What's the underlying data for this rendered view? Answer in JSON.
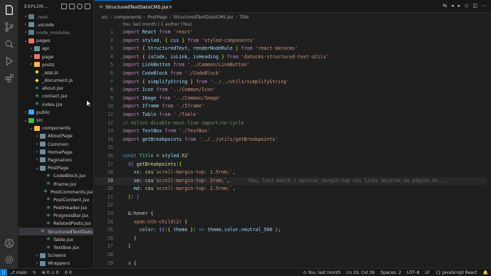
{
  "sidebar": {
    "title": "EXPLOR...",
    "tree": [
      {
        "name": ".next",
        "depth": 0,
        "type": "folder-dim",
        "chev": "›",
        "dim": true
      },
      {
        "name": ".vscode",
        "depth": 0,
        "type": "folder",
        "chev": "›"
      },
      {
        "name": "node_modules",
        "depth": 0,
        "type": "folder-dim",
        "chev": "›",
        "dim": true
      },
      {
        "name": "pages",
        "depth": 0,
        "type": "folder-pages",
        "chev": "⌄"
      },
      {
        "name": "api",
        "depth": 1,
        "type": "folder",
        "chev": "›"
      },
      {
        "name": "page",
        "depth": 1,
        "type": "folder-pages",
        "chev": "›"
      },
      {
        "name": "posts",
        "depth": 1,
        "type": "folder-comp",
        "chev": "›"
      },
      {
        "name": "_app.js",
        "depth": 1,
        "type": "file",
        "chev": ""
      },
      {
        "name": "_document.js",
        "depth": 1,
        "type": "file",
        "chev": ""
      },
      {
        "name": "about.jsx",
        "depth": 1,
        "type": "jsx",
        "chev": ""
      },
      {
        "name": "contact.jsx",
        "depth": 1,
        "type": "jsx",
        "chev": ""
      },
      {
        "name": "index.jsx",
        "depth": 1,
        "type": "jsx",
        "chev": ""
      },
      {
        "name": "public",
        "depth": 0,
        "type": "folder-pub",
        "chev": "›"
      },
      {
        "name": "src",
        "depth": 0,
        "type": "folder-src",
        "chev": "⌄"
      },
      {
        "name": "components",
        "depth": 1,
        "type": "folder-comp",
        "chev": "⌄"
      },
      {
        "name": "AboutPage",
        "depth": 2,
        "type": "folder",
        "chev": "›"
      },
      {
        "name": "Common",
        "depth": 2,
        "type": "folder",
        "chev": "›"
      },
      {
        "name": "HomePage",
        "depth": 2,
        "type": "folder",
        "chev": "›"
      },
      {
        "name": "Pagination",
        "depth": 2,
        "type": "folder",
        "chev": "›"
      },
      {
        "name": "PostPage",
        "depth": 2,
        "type": "folder",
        "chev": "⌄"
      },
      {
        "name": "CodeBlock.jsx",
        "depth": 3,
        "type": "jsx",
        "chev": ""
      },
      {
        "name": "Iframe.jsx",
        "depth": 3,
        "type": "jsx",
        "chev": ""
      },
      {
        "name": "PostComments.jsx",
        "depth": 3,
        "type": "jsx",
        "chev": ""
      },
      {
        "name": "PostContent.jsx",
        "depth": 3,
        "type": "jsx",
        "chev": ""
      },
      {
        "name": "PostHeader.jsx",
        "depth": 3,
        "type": "jsx",
        "chev": ""
      },
      {
        "name": "ProgressBar.jsx",
        "depth": 3,
        "type": "jsx",
        "chev": ""
      },
      {
        "name": "RelatedPosts.jsx",
        "depth": 3,
        "type": "jsx",
        "chev": ""
      },
      {
        "name": "StructuredTextDato...",
        "depth": 3,
        "type": "jsx",
        "chev": "",
        "selected": true
      },
      {
        "name": "Table.jsx",
        "depth": 3,
        "type": "jsx",
        "chev": ""
      },
      {
        "name": "TextBox.jsx",
        "depth": 3,
        "type": "jsx",
        "chev": ""
      },
      {
        "name": "Screens",
        "depth": 2,
        "type": "folder",
        "chev": "›"
      },
      {
        "name": "Wrappers",
        "depth": 2,
        "type": "folder",
        "chev": "›"
      }
    ]
  },
  "tab": {
    "label": "StructuredTextDatoCMS.jsx",
    "close": "×"
  },
  "breadcrumb": [
    "src",
    "components",
    "PostPage",
    "StructuredTextDatoCMS.jsx",
    "Title"
  ],
  "editor": {
    "blame_header": "You, last month | 1 author (You)",
    "current_line_blame": "You, last month • Aplicar margin-top nos links âncoras na página de..."
  },
  "code": [
    {
      "n": "1",
      "html": "<span class='kw'>import</span> <span class='id'>React</span> <span class='kw'>from</span> <span class='str'>'react'</span>"
    },
    {
      "n": "2",
      "html": "<span class='kw'>import</span> <span class='id'>styled</span><span class='plain'>, </span><span class='br'>{</span> <span class='id'>css</span> <span class='br'>}</span> <span class='kw'>from</span> <span class='str'>'styled-components'</span>"
    },
    {
      "n": "3",
      "html": "<span class='kw'>import</span> <span class='br'>{</span> <span class='id'>StructuredText</span><span class='plain'>, </span><span class='id'>renderNodeRule</span> <span class='br'>}</span> <span class='kw'>from</span> <span class='str'>'react-datocms'</span>"
    },
    {
      "n": "4",
      "html": "<span class='kw'>import</span> <span class='br'>{</span> <span class='id'>isCode</span><span class='plain'>, </span><span class='id'>isLink</span><span class='plain'>, </span><span class='id'>isHeading</span> <span class='br'>}</span> <span class='kw'>from</span> <span class='str'>'datocms-structured-text-utils'</span>"
    },
    {
      "n": "5",
      "html": "<span class='kw'>import</span> <span class='id'>LinkButton</span> <span class='kw'>from</span> <span class='str'>'../Common/LinkButton'</span>"
    },
    {
      "n": "6",
      "html": "<span class='kw'>import</span> <span class='id'>CodeBlock</span> <span class='kw'>from</span> <span class='str'>'./CodeBlock'</span>"
    },
    {
      "n": "7",
      "html": "<span class='kw'>import</span> <span class='br'>{</span> <span class='id'>simplifyString</span> <span class='br'>}</span> <span class='kw'>from</span> <span class='str'>'../../utils/simplifyString'</span>"
    },
    {
      "n": "8",
      "html": "<span class='kw'>import</span> <span class='id'>Icon</span> <span class='kw'>from</span> <span class='str'>'../Common/Icon'</span>"
    },
    {
      "n": "9",
      "html": "<span class='kw'>import</span> <span class='id'>Image</span> <span class='kw'>from</span> <span class='str'>'../Common/Image'</span>"
    },
    {
      "n": "10",
      "html": "<span class='kw'>import</span> <span class='id'>Iframe</span> <span class='kw'>from</span> <span class='str'>'./Iframe'</span>"
    },
    {
      "n": "11",
      "html": "<span class='kw'>import</span> <span class='id'>Table</span> <span class='kw'>from</span> <span class='str'>'./Table'</span>"
    },
    {
      "n": "12",
      "html": "<span class='cmt'>// eslint-disable-next-line import/no-cycle</span>"
    },
    {
      "n": "13",
      "html": "<span class='kw'>import</span> <span class='id'>TextBox</span> <span class='kw'>from</span> <span class='str'>'./TextBox'</span>"
    },
    {
      "n": "14",
      "html": "<span class='kw'>import</span> <span class='id'>getBreakpoints</span> <span class='kw'>from</span> <span class='str'>'../../utils/getBreakpoints'</span>"
    },
    {
      "n": "15",
      "html": ""
    },
    {
      "n": "16",
      "html": "<span class='kw2'>const</span> <span class='cls'>Title</span> <span class='plain'>=</span> <span class='id'>styled</span><span class='plain'>.</span><span class='fn'>h2</span><span class='tpl'>`</span>"
    },
    {
      "n": "17",
      "html": "  <span class='kw2'>$</span><span class='br2'>{</span> <span class='fn'>getBreakpoints</span><span class='br3'>(</span><span class='br'>{</span>"
    },
    {
      "n": "18",
      "html": "    <span class='prop'>xs</span><span class='plain'>:</span> <span class='fn'>css</span><span class='tpl'>`scroll-margin-top: 1.5rem;`</span><span class='plain'>,</span>"
    },
    {
      "n": "19",
      "html": "    <span class='prop'>sm</span><span class='plain'>:</span> <span class='fn'>css</span><span class='tpl'>`scroll-margin-top: 2rem;`</span><span class='plain'>,</span>",
      "current": true
    },
    {
      "n": "20",
      "html": "    <span class='prop'>md</span><span class='plain'>:</span> <span class='fn'>css</span><span class='tpl'>`scroll-margin-top: 2.5rem;`</span><span class='plain'>,</span>"
    },
    {
      "n": "21",
      "html": "  <span class='br'>}</span><span class='br3'>)</span> <span class='br2'>}</span>"
    },
    {
      "n": "22",
      "html": ""
    },
    {
      "n": "23",
      "html": "  <span class='plain'>&amp;:hover {</span>"
    },
    {
      "n": "24",
      "html": "    <span class='str'>span:nth-child(2)</span> <span class='plain'>{</span>"
    },
    {
      "n": "25",
      "html": "      <span class='prop'>color</span><span class='plain'>:</span> <span class='kw2'>$</span><span class='br2'>{</span><span class='br3'>(</span><span class='br'>{</span> <span class='id'>theme</span> <span class='br'>}</span><span class='br3'>)</span> <span class='kw2'>=&gt;</span> <span class='id'>theme</span><span class='plain'>.</span><span class='id'>color</span><span class='plain'>.</span><span class='id'>neutral_500</span> <span class='br2'>}</span><span class='plain'>;</span>"
    },
    {
      "n": "26",
      "html": "    <span class='plain'>}</span>"
    },
    {
      "n": "27",
      "html": "  <span class='plain'>}</span>"
    },
    {
      "n": "28",
      "html": ""
    },
    {
      "n": "29",
      "html": "  <span class='str'>a</span> <span class='plain'>{</span>"
    }
  ],
  "status": {
    "branch": "main",
    "problems": "⊗ 0 ⚠ 0",
    "ports": "0",
    "blame": "You, last month",
    "position": "Ln 19, Col 39",
    "spaces": "Spaces: 2",
    "encoding": "UTF-8",
    "eol": "LF",
    "language": "{} JavaScript React"
  }
}
